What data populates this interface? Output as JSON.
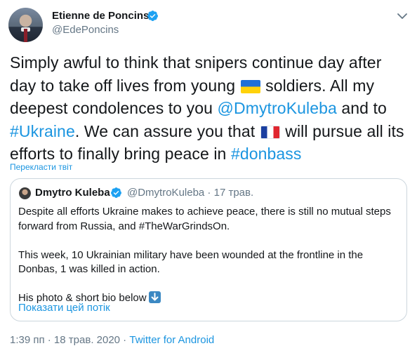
{
  "author": {
    "name": "Etienne de Poncins",
    "handle": "@EdePoncins"
  },
  "tweet": {
    "p1": "Simply awful to think that snipers continue day after day to take off lives from young ",
    "flag1": "flag-ukraine-icon",
    "p2": " soldiers. All my deepest condolences to you ",
    "mention": "@DmytroKuleba",
    "p3": " and to ",
    "hashtag1": "#Ukraine",
    "p4": ". We can assure you that ",
    "flag2": "flag-france-icon",
    "p5": " will pursue all its efforts to finally bring peace in ",
    "hashtag2": "#donbass"
  },
  "translate_label": "Перекласти твіт",
  "quoted": {
    "name": "Dmytro Kuleba",
    "handle_date": "@DmytroKuleba · 17 трав.",
    "para1": "Despite all efforts Ukraine makes to achieve peace, there is still no mutual steps forward from Russia, and #TheWarGrindsOn.",
    "para2": "This week, 10 Ukrainian military have been wounded at the frontline in the Donbas, 1 was killed in action.",
    "para3": "His photo & short bio below",
    "show_thread": "Показати цей потік"
  },
  "meta": {
    "time_date": "1:39 пп · 18 трав. 2020 · ",
    "source": "Twitter for Android"
  },
  "colors": {
    "link": "#1b95e0",
    "secondary_text": "#657786",
    "border": "#ccd6dd"
  }
}
